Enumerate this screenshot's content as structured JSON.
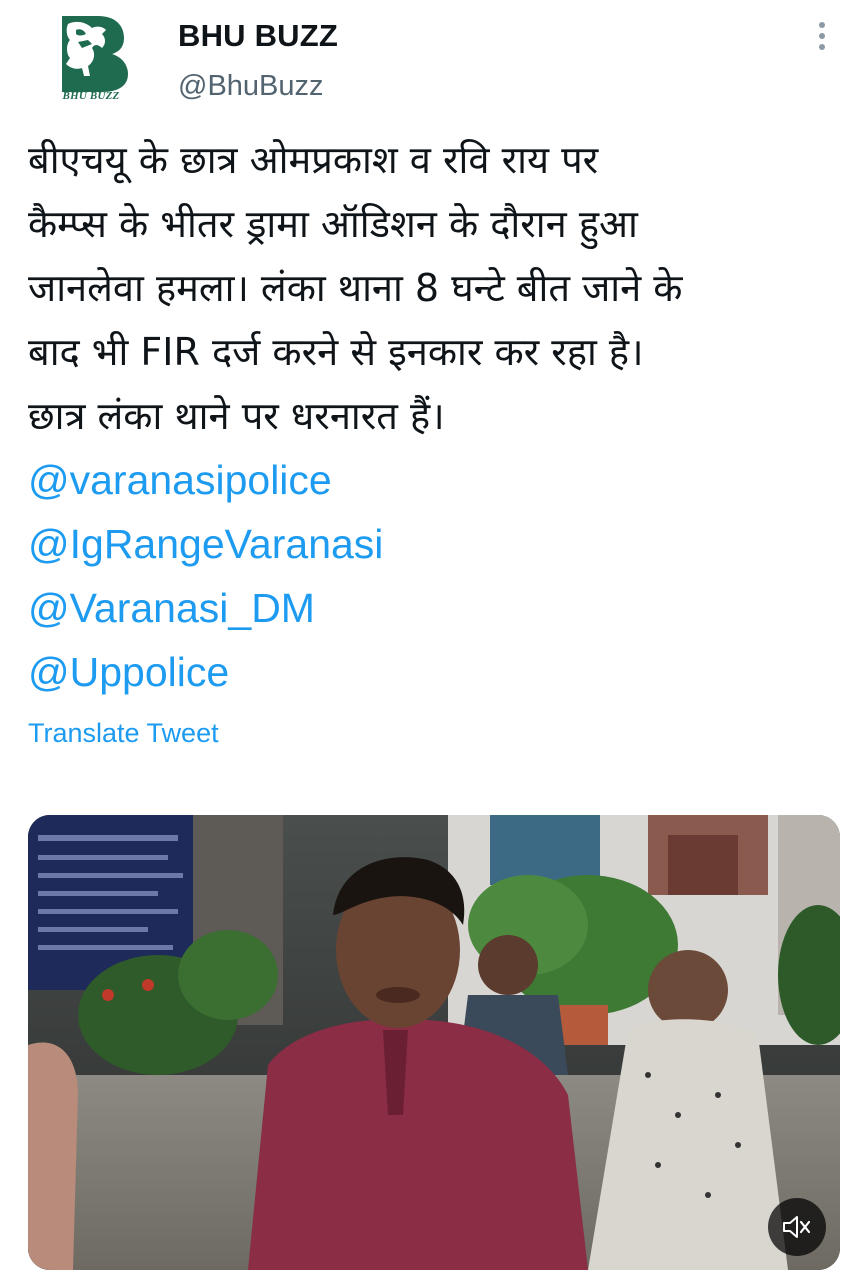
{
  "author": {
    "display_name": "BHU BUZZ",
    "handle": "@BhuBuzz",
    "avatar": {
      "icon": "bhu-buzz-logo-icon",
      "caption": "BHU BUZZ",
      "color": "#1f6b4f"
    }
  },
  "tweet": {
    "text_lines": [
      "बीएचयू के छात्र ओमप्रकाश व रवि राय पर",
      "कैम्प्स के भीतर ड्रामा ऑडिशन के दौरान हुआ",
      "जानलेवा हमला। लंका थाना 8 घन्टे बीत जाने के",
      "बाद भी FIR दर्ज करने से इनकार कर रहा है।",
      "छात्र लंका थाने पर धरनारत हैं।"
    ],
    "mentions": [
      "@varanasipolice",
      "@IgRangeVaranasi",
      "@Varanasi_DM",
      "@Uppolice"
    ],
    "translate_label": "Translate Tweet"
  },
  "media": {
    "type": "video",
    "mute_icon": "speaker-muted-icon"
  },
  "colors": {
    "link": "#1d9bf0",
    "text": "#0f1419",
    "secondary": "#536471",
    "brand": "#1f6b4f"
  },
  "icons": {
    "more": "more-vertical-icon"
  }
}
